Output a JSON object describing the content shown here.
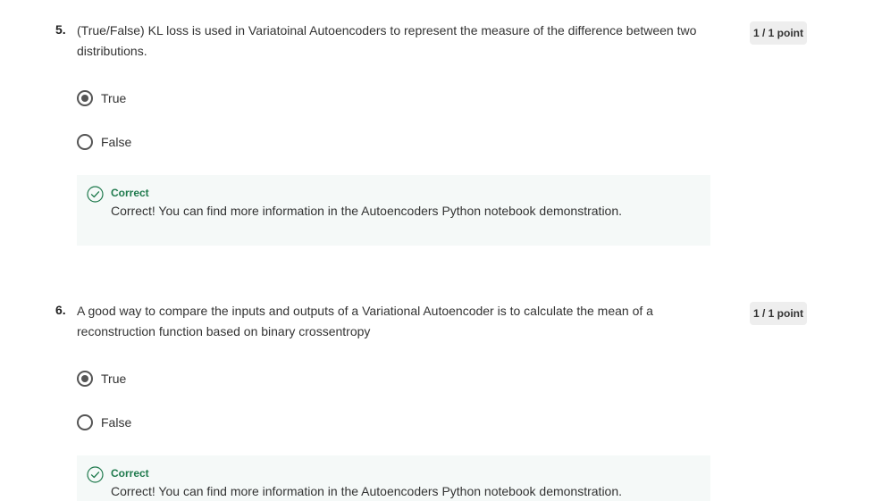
{
  "questions": [
    {
      "number": "5.",
      "text": "(True/False) KL loss is used in Variatoinal Autoencoders to represent the measure of the difference between two distributions.",
      "points": "1 / 1 point",
      "options": [
        {
          "label": "True",
          "selected": true
        },
        {
          "label": "False",
          "selected": false
        }
      ],
      "feedback": {
        "icon": "check-circle-icon",
        "title": "Correct",
        "text": "Correct! You can find more information in the Autoencoders Python notebook demonstration."
      }
    },
    {
      "number": "6.",
      "text": "A good way to compare the inputs and outputs of a Variational Autoencoder is to calculate the mean of a reconstruction function based on binary crossentropy",
      "points": "1 / 1 point",
      "options": [
        {
          "label": "True",
          "selected": true
        },
        {
          "label": "False",
          "selected": false
        }
      ],
      "feedback": {
        "icon": "check-circle-icon",
        "title": "Correct",
        "text": "Correct! You can find more information in the Autoencoders Python notebook demonstration."
      }
    }
  ],
  "colors": {
    "correct_green": "#1f7a4d",
    "feedback_bg": "#f5f9f8",
    "badge_bg": "#eeeeee"
  }
}
